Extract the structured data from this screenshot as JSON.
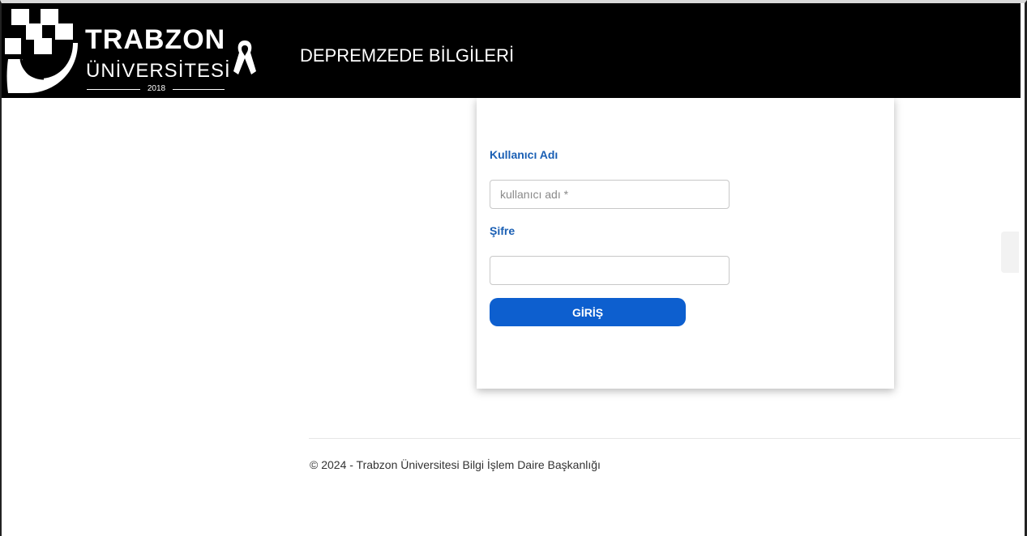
{
  "header": {
    "logo": {
      "line1": "TRABZON",
      "line2": "ÜNİVERSİTESİ",
      "year": "2018"
    },
    "title": "DEPREMZEDE BİLGİLERİ"
  },
  "login": {
    "username_label": "Kullanıcı Adı",
    "username_placeholder": "kullanıcı adı *",
    "username_value": "",
    "password_label": "Şifre",
    "password_value": "",
    "submit_label": "GİRİŞ"
  },
  "footer": {
    "copyright": "© 2024 - Trabzon Üniversitesi Bilgi İşlem Daire Başkanlığı"
  },
  "colors": {
    "header_bg": "#000000",
    "accent": "#0d5fcf",
    "label": "#1a5fb4"
  },
  "icons": {
    "logo": "university-logo-icon",
    "ribbon": "awareness-ribbon-icon"
  }
}
